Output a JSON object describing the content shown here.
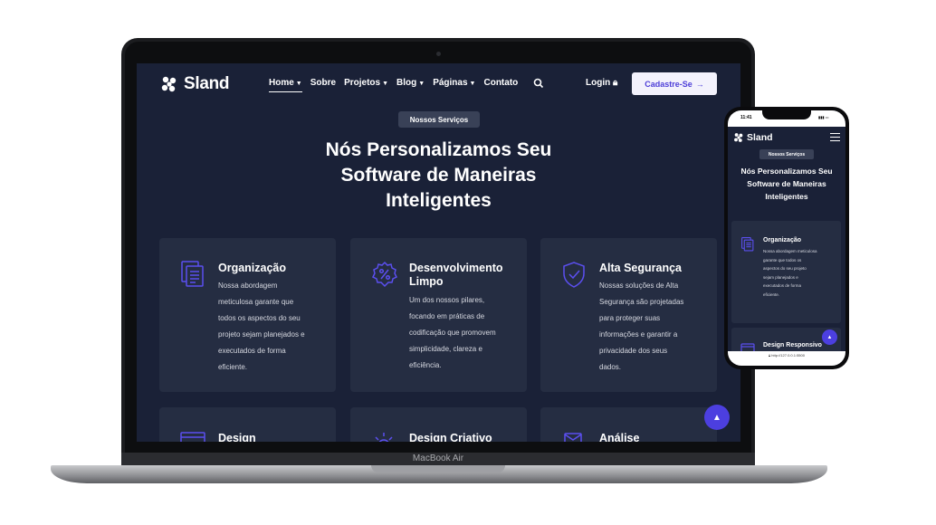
{
  "colors": {
    "bg": "#1a2137",
    "card": "#252d42",
    "accent": "#4c3fe0",
    "white": "#ffffff"
  },
  "laptop": {
    "brand": "MacBook Air"
  },
  "nav": {
    "logo": "Sland",
    "items": [
      {
        "label": "Home",
        "dropdown": true,
        "active": true
      },
      {
        "label": "Sobre",
        "dropdown": false
      },
      {
        "label": "Projetos",
        "dropdown": true
      },
      {
        "label": "Blog",
        "dropdown": true
      },
      {
        "label": "Páginas",
        "dropdown": true
      },
      {
        "label": "Contato",
        "dropdown": false
      }
    ],
    "search_icon": "search-icon",
    "login": "Login",
    "signup": "Cadastre-Se"
  },
  "section": {
    "pill": "Nossos Serviços",
    "title_lines": [
      "Nós Personalizamos Seu",
      "Software de Maneiras",
      "Inteligentes"
    ]
  },
  "cards": [
    {
      "icon": "document-icon",
      "title": "Organização",
      "desc_lines": [
        "Nossa abordagem",
        "meticulosa garante que",
        "todos os aspectos do seu",
        "projeto sejam planejados e",
        "executados de forma",
        "eficiente."
      ]
    },
    {
      "icon": "percent-gear-icon",
      "title_lines": [
        "Desenvolvimento",
        "Limpo"
      ],
      "desc_lines": [
        "Um dos nossos pilares,",
        "focando em práticas de",
        "codificação que promovem",
        "simplicidade, clareza e",
        "eficiência."
      ]
    },
    {
      "icon": "shield-check-icon",
      "title": "Alta Segurança",
      "desc_lines": [
        "Nossas soluções de Alta",
        "Segurança são projetadas",
        "para proteger suas",
        "informações e garantir a",
        "privacidade dos seus",
        "dados."
      ]
    }
  ],
  "cards_row2": [
    {
      "icon": "window-icon",
      "title": "Design"
    },
    {
      "icon": "sun-icon",
      "title": "Design Criativo"
    },
    {
      "icon": "mail-icon",
      "title": "Análise"
    }
  ],
  "phone": {
    "time": "11:41",
    "logo": "Sland",
    "pill": "Nossos Serviços",
    "title_lines": [
      "Nós Personalizamos Seu",
      "Software de Maneiras",
      "Inteligentes"
    ],
    "card_title": "Organização",
    "card_desc_lines": [
      "Nossa abordagem meticulosa",
      "garante que todos os",
      "aspectos do seu projeto",
      "sejam planejados e",
      "executados de forma",
      "eficiente."
    ],
    "card2_title": "Design Responsivo",
    "url": "http://127.0.0.1:5500"
  }
}
